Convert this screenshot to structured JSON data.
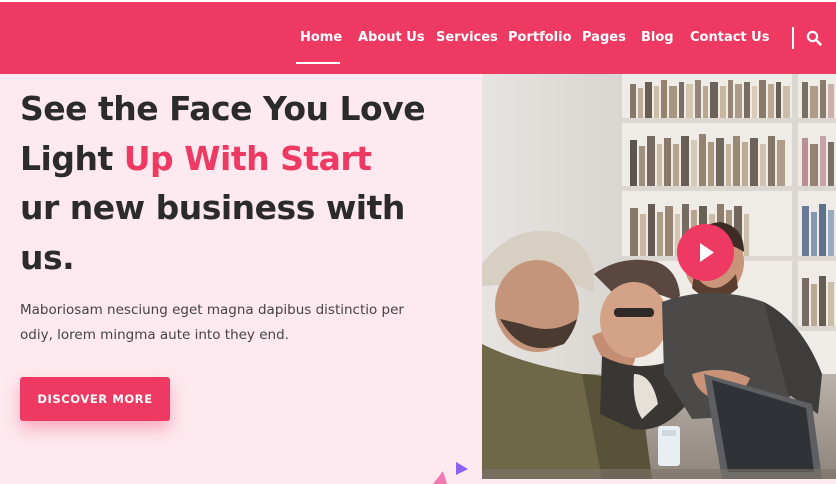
{
  "nav": {
    "items": [
      {
        "label": "Home"
      },
      {
        "label": "About Us"
      },
      {
        "label": "Services"
      },
      {
        "label": "Portfolio"
      },
      {
        "label": "Pages"
      },
      {
        "label": "Blog"
      },
      {
        "label": "Contact Us"
      }
    ],
    "active": "Home"
  },
  "hero": {
    "title_line1": "See the Face You Love",
    "title_line2_prefix": "Light ",
    "title_line2_accent": "Up With Start",
    "title_line3": "ur new business with",
    "title_line4": "us.",
    "description": "Maboriosam nesciung eget magna dapibus distinctio per odiy, lorem mingma aute into they end.",
    "cta_label": "DISCOVER MORE"
  },
  "colors": {
    "accent": "#ee3a62",
    "background": "#fde9ef",
    "heading": "#2b2b2b",
    "deco_purple": "#8a63f5"
  },
  "icons": {
    "search": "search-icon",
    "play": "play-icon"
  }
}
